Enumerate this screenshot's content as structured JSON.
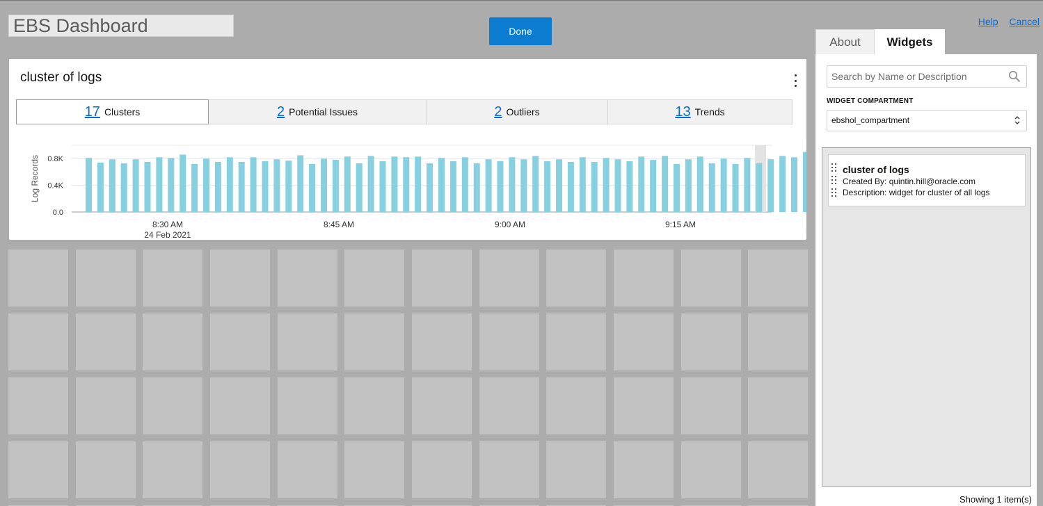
{
  "header": {
    "dashboard_title": "EBS Dashboard",
    "done_label": "Done",
    "help_label": "Help",
    "cancel_label": "Cancel"
  },
  "widget": {
    "title": "cluster of logs",
    "tabs": [
      {
        "count": "17",
        "label": "Clusters",
        "active": true
      },
      {
        "count": "2",
        "label": "Potential Issues",
        "active": false
      },
      {
        "count": "2",
        "label": "Outliers",
        "active": false
      },
      {
        "count": "13",
        "label": "Trends",
        "active": false
      }
    ]
  },
  "chart_data": {
    "type": "bar",
    "ylabel": "Log Records",
    "y_ticks": [
      "0.0",
      "0.4K",
      "0.8K"
    ],
    "ylim": [
      0,
      1000
    ],
    "x_tick_labels": [
      "8:30 AM",
      "8:45 AM",
      "9:00 AM",
      "9:15 AM"
    ],
    "x_tick_sublabel": "24 Feb 2021",
    "bar_color": "#86d0e0",
    "values": [
      810,
      740,
      790,
      730,
      790,
      750,
      820,
      810,
      860,
      720,
      800,
      750,
      820,
      750,
      820,
      760,
      790,
      770,
      850,
      720,
      800,
      780,
      830,
      730,
      840,
      760,
      830,
      820,
      830,
      730,
      810,
      760,
      820,
      730,
      790,
      760,
      820,
      790,
      840,
      760,
      790,
      750,
      820,
      750,
      810,
      790,
      760,
      830,
      780,
      840,
      720,
      790,
      830,
      730,
      800,
      720,
      810,
      730,
      790,
      840,
      820,
      900,
      470
    ]
  },
  "panel": {
    "tab_about": "About",
    "tab_widgets": "Widgets",
    "search_placeholder": "Search by Name or Description",
    "compartment_label": "WIDGET COMPARTMENT",
    "compartment_value": "ebshol_compartment",
    "items": [
      {
        "title": "cluster of logs",
        "created_by": "Created By: quintin.hill@oracle.com",
        "description": "Description: widget for cluster of all logs"
      }
    ],
    "showing": "Showing 1 item(s)"
  },
  "colors": {
    "accent": "#0b7ccf",
    "link": "#0a6bd6",
    "bar": "#86d0e0"
  }
}
